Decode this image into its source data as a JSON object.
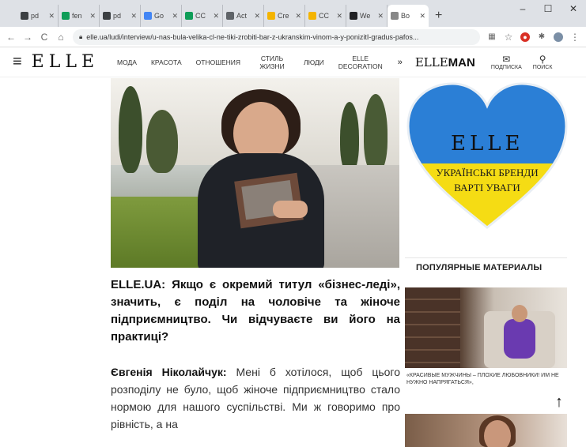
{
  "browser": {
    "tabs": [
      {
        "label": "pd",
        "color": "#3c4043"
      },
      {
        "label": "fen",
        "color": "#0f9d58"
      },
      {
        "label": "pd",
        "color": "#3c4043"
      },
      {
        "label": "Go",
        "color": "#4285f4"
      },
      {
        "label": "CC",
        "color": "#0f9d58"
      },
      {
        "label": "Act",
        "color": "#5f6368"
      },
      {
        "label": "Cre",
        "color": "#f4b400"
      },
      {
        "label": "CC",
        "color": "#f4b400"
      },
      {
        "label": "We",
        "color": "#202124"
      },
      {
        "label": "Bo",
        "color": "#888888"
      }
    ],
    "new_tab": "+",
    "window_controls": [
      "–",
      "☐",
      "✕"
    ],
    "url": "elle.ua/ludi/interview/u-nas-bula-velika-cl-ne-tiki-zrobiti-bar-z-ukranskim-vinom-a-y-ponizitI-gradus-pafos..."
  },
  "header": {
    "menu_items": [
      {
        "label": "МОДА"
      },
      {
        "label": "КРАСОТА"
      },
      {
        "label": "ОТНОШЕНИЯ"
      },
      {
        "label": "СТИЛЬ ЖИЗНИ"
      },
      {
        "label": "ЛЮДИ"
      },
      {
        "label": "ELLE DECORATION"
      }
    ],
    "chevron": "»",
    "subscribe_label": "ПОДПИСКА",
    "search_label": "ПОИСК"
  },
  "article": {
    "question": "ELLE.UA: Якщо є окремий титул «бізнес-леді», значить, є поділ на чоловіче та жіноче підприємництво. Чи відчуваєте ви його на практиці?",
    "speaker": "Євгенія Ніколайчук:",
    "answer": " Мені б хотілося, щоб цього розподілу не було, щоб жіноче підприємництво стало нормою для нашого суспільстві. Ми ж говоримо про рівність, а на"
  },
  "sidebar": {
    "banner": {
      "logo": "ELLE",
      "line1": "УКРАЇНСЬКІ БРЕНДИ",
      "line2": "ВАРТІ УВАГИ",
      "colors": {
        "blue": "#2b7fd6",
        "yellow": "#f5dc14"
      }
    },
    "popular_title": "ПОПУЛЯРНЫЕ МАТЕРИАЛЫ",
    "card1_caption": "«КРАСИВЫЕ МУЖЧИНЫ – ПЛОХИЕ ЛЮБОВНИКИ! ИМ НЕ НУЖНО НАПРЯГАТЬСЯ»,"
  }
}
